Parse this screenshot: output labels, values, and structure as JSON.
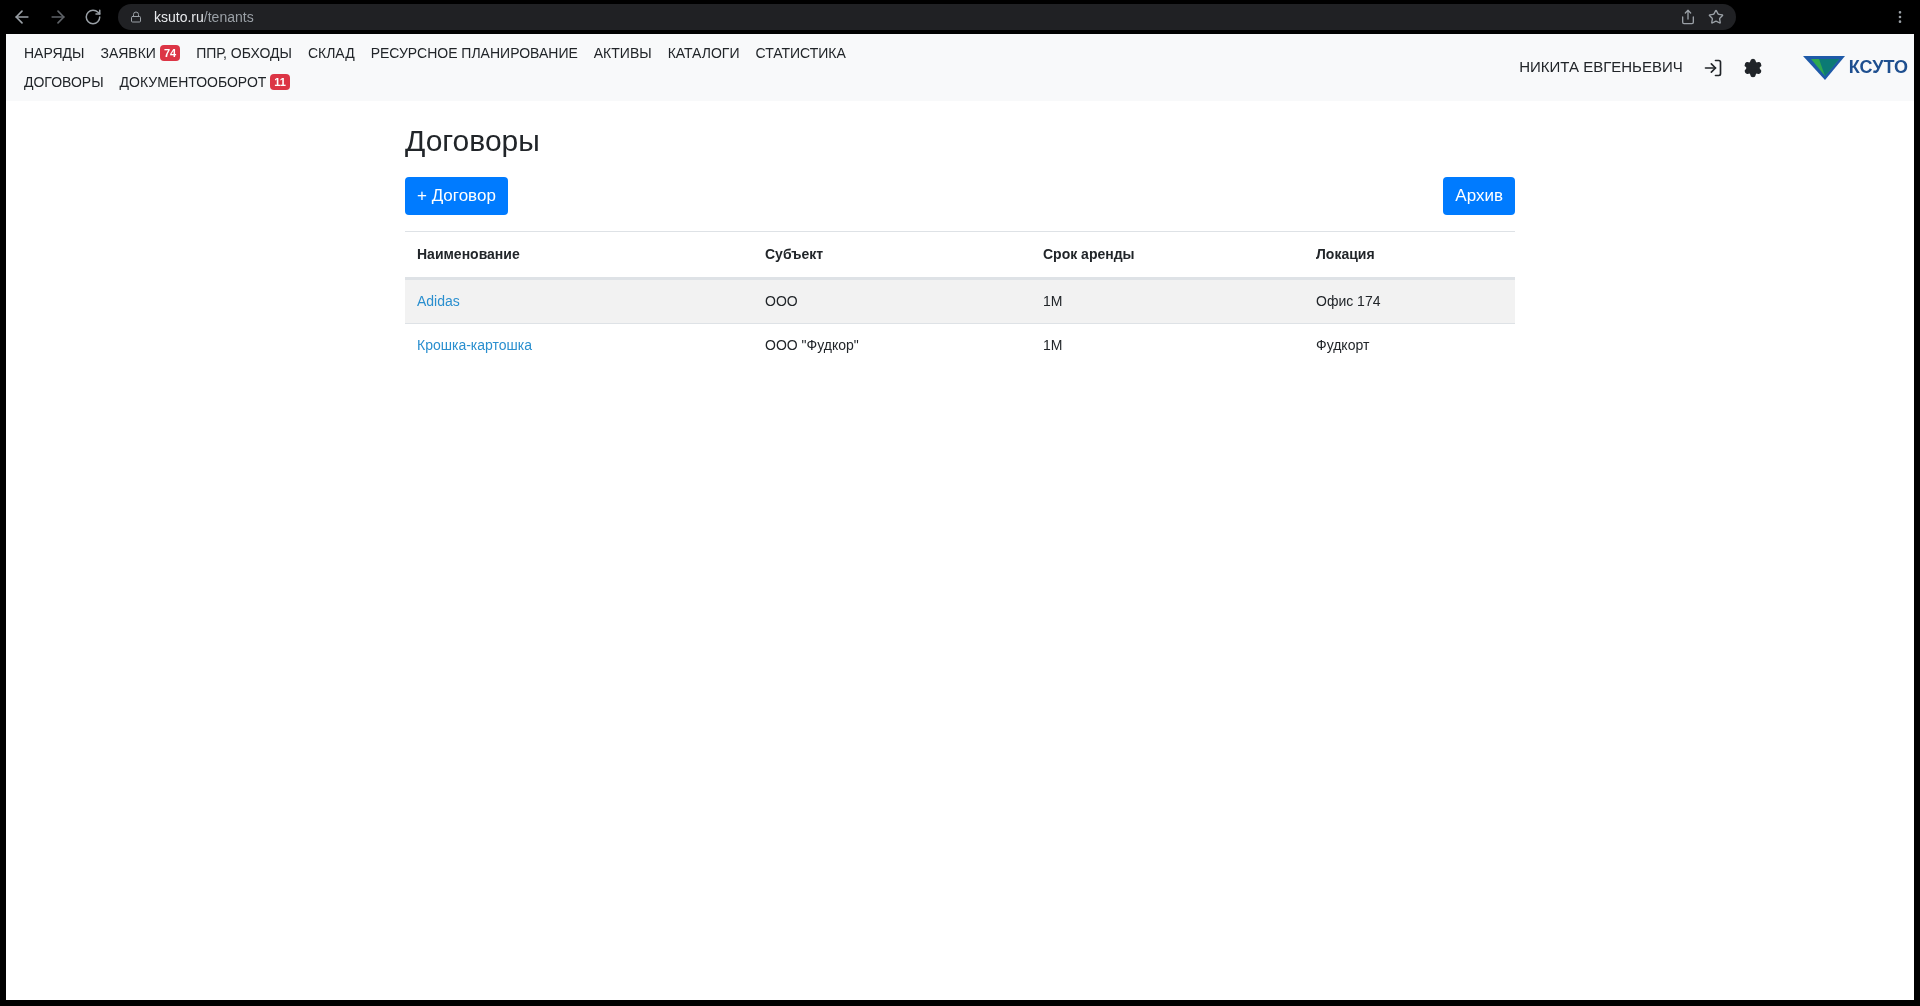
{
  "browser": {
    "url_host": "ksuto.ru",
    "url_path": "/tenants"
  },
  "nav": {
    "items": [
      {
        "label": "НАРЯДЫ"
      },
      {
        "label": "ЗАЯВКИ",
        "badge": "74"
      },
      {
        "label": "ППР, ОБХОДЫ"
      },
      {
        "label": "СКЛАД"
      },
      {
        "label": "РЕСУРСНОЕ ПЛАНИРОВАНИЕ"
      },
      {
        "label": "АКТИВЫ"
      },
      {
        "label": "КАТАЛОГИ"
      },
      {
        "label": "СТАТИСТИКА"
      },
      {
        "label": "ДОГОВОРЫ"
      },
      {
        "label": "ДОКУМЕНТООБОРОТ",
        "badge": "11"
      }
    ],
    "user": "НИКИТА ЕВГЕНЬЕВИЧ",
    "logo_text": "КСУТО"
  },
  "page": {
    "title": "Договоры",
    "add_button": "+ Договор",
    "archive_button": "Архив"
  },
  "table": {
    "columns": [
      "Наименование",
      "Субъект",
      "Срок аренды",
      "Локация"
    ],
    "rows": [
      {
        "cells": [
          "Adidas",
          "ООО",
          "1М",
          "Офис 174"
        ],
        "highlighted": true
      },
      {
        "cells": [
          "Крошка-картошка",
          "ООО \"Фудкор\"",
          "1М",
          "Фудкорт"
        ],
        "highlighted": false
      }
    ]
  }
}
